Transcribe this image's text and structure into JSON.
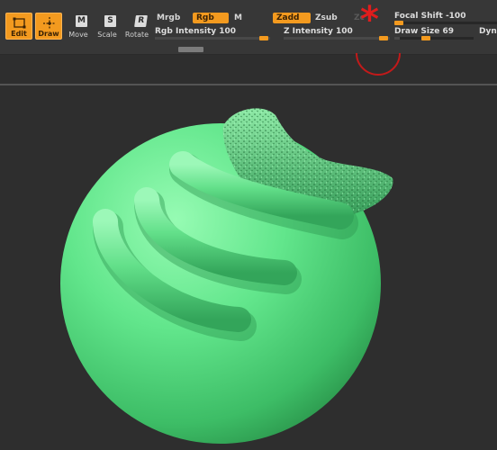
{
  "toolbar": {
    "tools": [
      {
        "id": "edit",
        "label": "Edit",
        "active": true
      },
      {
        "id": "draw",
        "label": "Draw",
        "active": true
      },
      {
        "id": "move",
        "label": "Move",
        "key": "M",
        "active": false
      },
      {
        "id": "scale",
        "label": "Scale",
        "key": "S",
        "active": false
      },
      {
        "id": "rotate",
        "label": "Rotate",
        "key": "R",
        "active": false
      }
    ],
    "modes": {
      "mrgb": "Mrgb",
      "rgb": "Rgb",
      "m": "M",
      "zadd": "Zadd",
      "zsub": "Zsub",
      "zcut": "Zc"
    },
    "sliders": {
      "rgb_intensity": {
        "label": "Rgb Intensity",
        "value": "100",
        "fraction": 1.0
      },
      "z_intensity": {
        "label": "Z Intensity",
        "value": "100",
        "fraction": 1.0
      },
      "focal_shift": {
        "label": "Focal Shift",
        "value": "-100",
        "fraction": 0.0
      },
      "draw_size": {
        "label": "Draw Size",
        "value": "69",
        "fraction": 0.07
      },
      "dynamic": {
        "label": "Dyna"
      }
    }
  },
  "colors": {
    "accent": "#f39a1f",
    "toolbar_bg": "#373737",
    "canvas_bg": "#2e2e2e",
    "annotation_star": "#e01d1d",
    "sculpt_green": "#5fe389"
  },
  "canvas": {
    "object": "sculpted-sphere"
  }
}
